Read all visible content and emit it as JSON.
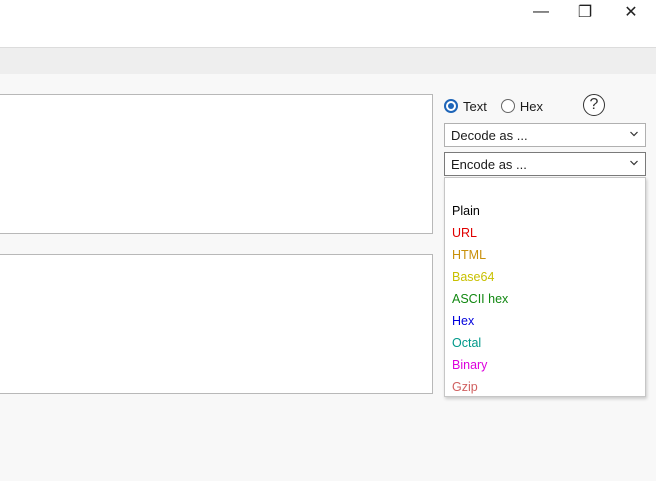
{
  "window": {
    "minimize_glyph": "—",
    "maximize_glyph": "❐",
    "close_glyph": "✕"
  },
  "mode": {
    "options": [
      {
        "label": "Text",
        "checked": true
      },
      {
        "label": "Hex",
        "checked": false
      }
    ],
    "help_glyph": "?"
  },
  "decode_select": {
    "value": "Decode as ..."
  },
  "encode_select": {
    "value": "Encode as ...",
    "open": true
  },
  "encode_options": [
    {
      "label": "",
      "color": "#000000"
    },
    {
      "label": "Plain",
      "color": "#000000"
    },
    {
      "label": "URL",
      "color": "#e00000"
    },
    {
      "label": "HTML",
      "color": "#c8900a"
    },
    {
      "label": "Base64",
      "color": "#c8c000"
    },
    {
      "label": "ASCII hex",
      "color": "#118811"
    },
    {
      "label": "Hex",
      "color": "#0000dd"
    },
    {
      "label": "Octal",
      "color": "#00998a"
    },
    {
      "label": "Binary",
      "color": "#dd00dd"
    },
    {
      "label": "Gzip",
      "color": "#d06060"
    }
  ]
}
